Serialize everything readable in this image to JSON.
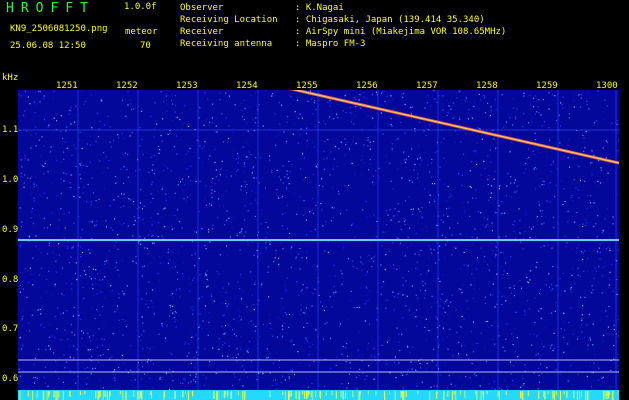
{
  "header": {
    "title": "HROFFT",
    "version": "1.0.0f",
    "filename": "KN9_2506081250.png",
    "count_label": "meteor",
    "datetime": "25.06.08 12:50",
    "count_value": "70"
  },
  "info": [
    {
      "label": "Observer",
      "value": "K.Nagai"
    },
    {
      "label": "Receiving Location",
      "value": "Chigasaki, Japan (139.414 35.340)"
    },
    {
      "label": "Receiver",
      "value": "AirSpy mini (Miakejima VOR 108.65MHz)"
    },
    {
      "label": "Receiving antenna",
      "value": "Maspro FM-3"
    }
  ],
  "axis": {
    "unit": "kHz",
    "time_ticks": [
      "1251",
      "1252",
      "1253",
      "1254",
      "1255",
      "1256",
      "1257",
      "1258",
      "1259",
      "1300"
    ],
    "freq_ticks": [
      "1.1",
      "1.0",
      "0.9",
      "0.8",
      "0.7",
      "0.6"
    ]
  },
  "colors": {
    "background": "#04089a",
    "text_yellow": "#ffff00",
    "text_green": "#22ff22",
    "signal": "#8fd8ff"
  }
}
